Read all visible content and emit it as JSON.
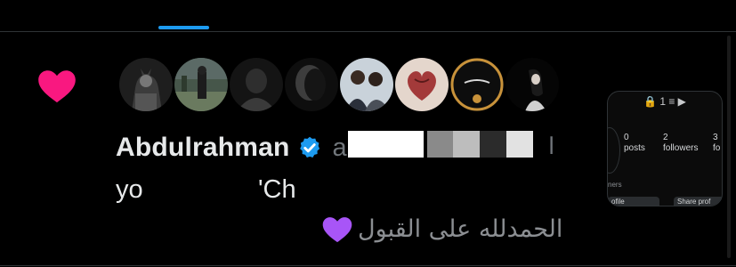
{
  "notification": {
    "display_name": "Abdulrahman",
    "handle_visible": "a",
    "handle_trailing": "ا",
    "bio_start": "yo",
    "bio_end": "'Ch",
    "message": "الحمدلله على القبول",
    "message_emoji": "purple-heart-icon"
  },
  "avatars": [
    {
      "name": "avatar-batman",
      "colors": [
        "#2b2b2b",
        "#9a9a9a"
      ]
    },
    {
      "name": "avatar-street",
      "colors": [
        "#3a4a3a",
        "#7a8a70"
      ]
    },
    {
      "name": "avatar-dark-portrait",
      "colors": [
        "#1a1a1a",
        "#555555"
      ]
    },
    {
      "name": "avatar-shadow",
      "colors": [
        "#141414",
        "#6a6a6a"
      ]
    },
    {
      "name": "avatar-two-men",
      "colors": [
        "#b9c3cc",
        "#3a3a3a"
      ]
    },
    {
      "name": "avatar-heart-drawing",
      "colors": [
        "#e8d8d0",
        "#7a2a2a"
      ]
    },
    {
      "name": "avatar-gold-logo",
      "colors": [
        "#111111",
        "#c8923a"
      ]
    },
    {
      "name": "avatar-woman-dark",
      "colors": [
        "#050505",
        "#d8d8d8"
      ]
    }
  ],
  "preview_card": {
    "top_text": "🔒 1  ≡  ▶",
    "stats": [
      {
        "value": "0",
        "label": "posts"
      },
      {
        "value": "2",
        "label": "followers"
      },
      {
        "value": "3",
        "label": "fo"
      }
    ],
    "subtitle": "ners",
    "buttons": [
      "ofile",
      "Share prof"
    ]
  },
  "colors": {
    "accent": "#1d9bf0",
    "like": "#f91880",
    "verified": "#1d9bf0",
    "purple_heart": "#a855f7"
  }
}
